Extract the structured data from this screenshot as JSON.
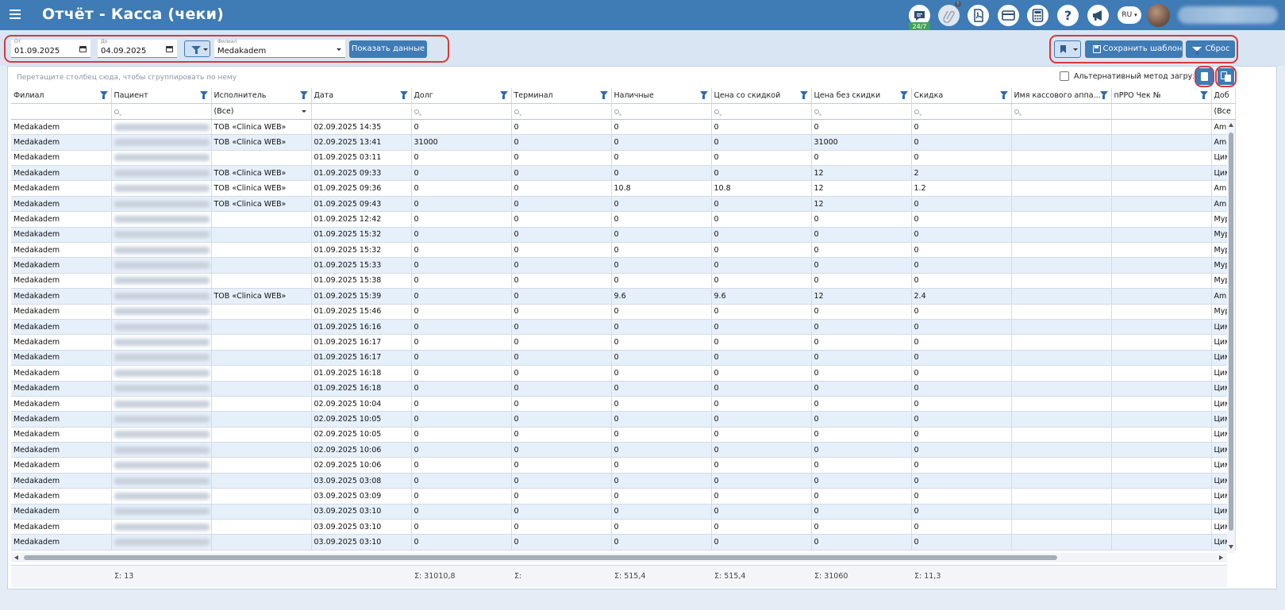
{
  "header": {
    "title": "Отчёт - Касса (чеки)",
    "support_badge": "24/7",
    "notification_badge": "!",
    "language": "RU",
    "icons": [
      "chat-icon",
      "attachment-icon",
      "pdf-icon",
      "card-icon",
      "calculator-icon",
      "help-icon",
      "megaphone-icon"
    ]
  },
  "filters": {
    "from_label": "От",
    "from_value": "01.09.2025",
    "to_label": "До",
    "to_value": "04.09.2025",
    "branch_label": "Филиал",
    "branch_value": "Medakadem",
    "show_button": "Показать данные",
    "save_template_button": "Сохранить шаблон",
    "reset_button": "Сброс"
  },
  "grid": {
    "group_hint": "Перетащите столбец сюда, чтобы сгруппировать по нему",
    "alt_method_label": "Альтернативный метод загрузки",
    "columns": [
      "Филиал",
      "Пациент",
      "Исполнитель",
      "Дата",
      "Долг",
      "Терминал",
      "Наличные",
      "Цена со скидкой",
      "Цена без скидки",
      "Скидка",
      "Имя кассового аппа...",
      "пРРО Чек №",
      "Доб"
    ],
    "executor_filter": "(Все)",
    "last_filter": "(Все",
    "rows": [
      {
        "branch": "Medakadem",
        "executor": "ТОВ «Clinica WEB»",
        "date": "02.09.2025 14:35",
        "debt": "0",
        "terminal": "0",
        "cash": "0",
        "price_disc": "0",
        "price_full": "0",
        "discount": "0",
        "last": "Am"
      },
      {
        "branch": "Medakadem",
        "executor": "ТОВ «Clinica WEB»",
        "date": "02.09.2025 13:41",
        "debt": "31000",
        "terminal": "0",
        "cash": "0",
        "price_disc": "0",
        "price_full": "31000",
        "discount": "0",
        "last": "Am"
      },
      {
        "branch": "Medakadem",
        "executor": "",
        "date": "01.09.2025 03:11",
        "debt": "0",
        "terminal": "0",
        "cash": "0",
        "price_disc": "0",
        "price_full": "0",
        "discount": "0",
        "last": "Цим"
      },
      {
        "branch": "Medakadem",
        "executor": "ТОВ «Clinica WEB»",
        "date": "01.09.2025 09:33",
        "debt": "0",
        "terminal": "0",
        "cash": "0",
        "price_disc": "0",
        "price_full": "12",
        "discount": "2",
        "last": "Цим"
      },
      {
        "branch": "Medakadem",
        "executor": "ТОВ «Clinica WEB»",
        "date": "01.09.2025 09:36",
        "debt": "0",
        "terminal": "0",
        "cash": "10.8",
        "price_disc": "10.8",
        "price_full": "12",
        "discount": "1.2",
        "last": "Am"
      },
      {
        "branch": "Medakadem",
        "executor": "ТОВ «Clinica WEB»",
        "date": "01.09.2025 09:43",
        "debt": "0",
        "terminal": "0",
        "cash": "0",
        "price_disc": "0",
        "price_full": "12",
        "discount": "0",
        "last": "Am"
      },
      {
        "branch": "Medakadem",
        "executor": "",
        "date": "01.09.2025 12:42",
        "debt": "0",
        "terminal": "0",
        "cash": "0",
        "price_disc": "0",
        "price_full": "0",
        "discount": "0",
        "last": "Мур"
      },
      {
        "branch": "Medakadem",
        "executor": "",
        "date": "01.09.2025 15:32",
        "debt": "0",
        "terminal": "0",
        "cash": "0",
        "price_disc": "0",
        "price_full": "0",
        "discount": "0",
        "last": "Мур"
      },
      {
        "branch": "Medakadem",
        "executor": "",
        "date": "01.09.2025 15:32",
        "debt": "0",
        "terminal": "0",
        "cash": "0",
        "price_disc": "0",
        "price_full": "0",
        "discount": "0",
        "last": "Мур"
      },
      {
        "branch": "Medakadem",
        "executor": "",
        "date": "01.09.2025 15:33",
        "debt": "0",
        "terminal": "0",
        "cash": "0",
        "price_disc": "0",
        "price_full": "0",
        "discount": "0",
        "last": "Мур"
      },
      {
        "branch": "Medakadem",
        "executor": "",
        "date": "01.09.2025 15:38",
        "debt": "0",
        "terminal": "0",
        "cash": "0",
        "price_disc": "0",
        "price_full": "0",
        "discount": "0",
        "last": "Мур"
      },
      {
        "branch": "Medakadem",
        "executor": "ТОВ «Clinica WEB»",
        "date": "01.09.2025 15:39",
        "debt": "0",
        "terminal": "0",
        "cash": "9.6",
        "price_disc": "9.6",
        "price_full": "12",
        "discount": "2.4",
        "last": "Am"
      },
      {
        "branch": "Medakadem",
        "executor": "",
        "date": "01.09.2025 15:46",
        "debt": "0",
        "terminal": "0",
        "cash": "0",
        "price_disc": "0",
        "price_full": "0",
        "discount": "0",
        "last": "Мур"
      },
      {
        "branch": "Medakadem",
        "executor": "",
        "date": "01.09.2025 16:16",
        "debt": "0",
        "terminal": "0",
        "cash": "0",
        "price_disc": "0",
        "price_full": "0",
        "discount": "0",
        "last": "Цим"
      },
      {
        "branch": "Medakadem",
        "executor": "",
        "date": "01.09.2025 16:17",
        "debt": "0",
        "terminal": "0",
        "cash": "0",
        "price_disc": "0",
        "price_full": "0",
        "discount": "0",
        "last": "Цим"
      },
      {
        "branch": "Medakadem",
        "executor": "",
        "date": "01.09.2025 16:17",
        "debt": "0",
        "terminal": "0",
        "cash": "0",
        "price_disc": "0",
        "price_full": "0",
        "discount": "0",
        "last": "Цим"
      },
      {
        "branch": "Medakadem",
        "executor": "",
        "date": "01.09.2025 16:18",
        "debt": "0",
        "terminal": "0",
        "cash": "0",
        "price_disc": "0",
        "price_full": "0",
        "discount": "0",
        "last": "Цим"
      },
      {
        "branch": "Medakadem",
        "executor": "",
        "date": "01.09.2025 16:18",
        "debt": "0",
        "terminal": "0",
        "cash": "0",
        "price_disc": "0",
        "price_full": "0",
        "discount": "0",
        "last": "Цим"
      },
      {
        "branch": "Medakadem",
        "executor": "",
        "date": "02.09.2025 10:04",
        "debt": "0",
        "terminal": "0",
        "cash": "0",
        "price_disc": "0",
        "price_full": "0",
        "discount": "0",
        "last": "Цим"
      },
      {
        "branch": "Medakadem",
        "executor": "",
        "date": "02.09.2025 10:05",
        "debt": "0",
        "terminal": "0",
        "cash": "0",
        "price_disc": "0",
        "price_full": "0",
        "discount": "0",
        "last": "Цим"
      },
      {
        "branch": "Medakadem",
        "executor": "",
        "date": "02.09.2025 10:05",
        "debt": "0",
        "terminal": "0",
        "cash": "0",
        "price_disc": "0",
        "price_full": "0",
        "discount": "0",
        "last": "Цим"
      },
      {
        "branch": "Medakadem",
        "executor": "",
        "date": "02.09.2025 10:06",
        "debt": "0",
        "terminal": "0",
        "cash": "0",
        "price_disc": "0",
        "price_full": "0",
        "discount": "0",
        "last": "Цим"
      },
      {
        "branch": "Medakadem",
        "executor": "",
        "date": "02.09.2025 10:06",
        "debt": "0",
        "terminal": "0",
        "cash": "0",
        "price_disc": "0",
        "price_full": "0",
        "discount": "0",
        "last": "Цим"
      },
      {
        "branch": "Medakadem",
        "executor": "",
        "date": "03.09.2025 03:08",
        "debt": "0",
        "terminal": "0",
        "cash": "0",
        "price_disc": "0",
        "price_full": "0",
        "discount": "0",
        "last": "Цим"
      },
      {
        "branch": "Medakadem",
        "executor": "",
        "date": "03.09.2025 03:09",
        "debt": "0",
        "terminal": "0",
        "cash": "0",
        "price_disc": "0",
        "price_full": "0",
        "discount": "0",
        "last": "Цим"
      },
      {
        "branch": "Medakadem",
        "executor": "",
        "date": "03.09.2025 03:10",
        "debt": "0",
        "terminal": "0",
        "cash": "0",
        "price_disc": "0",
        "price_full": "0",
        "discount": "0",
        "last": "Цим"
      },
      {
        "branch": "Medakadem",
        "executor": "",
        "date": "03.09.2025 03:10",
        "debt": "0",
        "terminal": "0",
        "cash": "0",
        "price_disc": "0",
        "price_full": "0",
        "discount": "0",
        "last": "Цим"
      },
      {
        "branch": "Medakadem",
        "executor": "",
        "date": "03.09.2025 03:10",
        "debt": "0",
        "terminal": "0",
        "cash": "0",
        "price_disc": "0",
        "price_full": "0",
        "discount": "0",
        "last": "Цим"
      }
    ],
    "totals": {
      "patient": "Σ: 13",
      "debt": "Σ: 31010,8",
      "terminal": "Σ:",
      "cash": "Σ: 515,4",
      "price_disc": "Σ: 515,4",
      "price_full": "Σ: 31060",
      "discount": "Σ: 11,3"
    }
  },
  "colors": {
    "header_bg": "#3f7bb4",
    "highlight_border": "#d9383a",
    "row_alt": "#e6f0fb",
    "support_badge": "#3da35a"
  }
}
